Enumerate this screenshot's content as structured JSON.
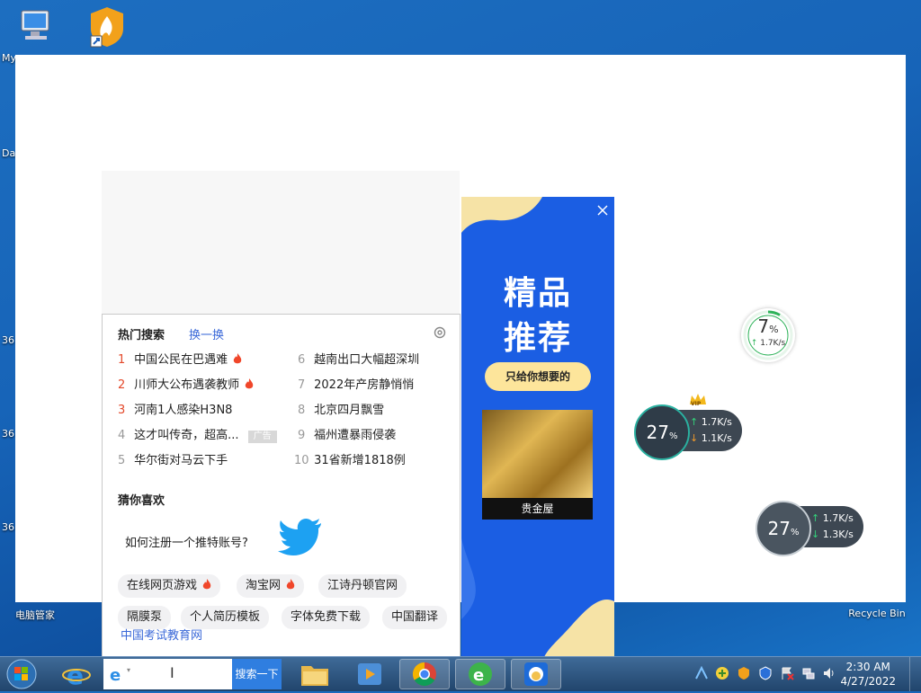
{
  "desktop": {
    "icons": {
      "computer_label": "My",
      "pc_manager_label": "电脑管家",
      "recycle_bin_label": "Recycle Bin"
    },
    "edge_labels": [
      "Da",
      "36",
      "36",
      "36"
    ]
  },
  "search_dropdown": {
    "hot_title": "热门搜索",
    "refresh_label": "换一换",
    "hot_items": [
      {
        "rank": "1",
        "text": "中国公民在巴遇难"
      },
      {
        "rank": "2",
        "text": "川师大公布遇袭教师"
      },
      {
        "rank": "3",
        "text": "河南1人感染H3N8"
      },
      {
        "rank": "4",
        "text": "这才叫传奇，超高..."
      },
      {
        "rank": "5",
        "text": "华尔街对马云下手"
      },
      {
        "rank": "6",
        "text": "越南出口大幅超深圳"
      },
      {
        "rank": "7",
        "text": "2022年产房静悄悄"
      },
      {
        "rank": "8",
        "text": "北京四月飘雪"
      },
      {
        "rank": "9",
        "text": "福州遭暴雨侵袭"
      },
      {
        "rank": "10",
        "text": "31省新增1818例"
      }
    ],
    "ad_tag": "广告",
    "guess_title": "猜你喜欢",
    "guess_question": "如何注册一个推特账号?",
    "chips": [
      "在线网页游戏",
      "淘宝网",
      "江诗丹顿官网",
      "隔膜泵",
      "个人简历模板",
      "字体免费下载",
      "中国翻译"
    ],
    "bottom_link": "中国考试教育网"
  },
  "ad_panel": {
    "title_line1": "精品",
    "title_line2": "推荐",
    "pill": "只给你想要的",
    "caption": "贵金屋"
  },
  "speed_widget_small": {
    "percent": "7",
    "unit": "%",
    "rate": "1.7K/s"
  },
  "speed_widget_vip": {
    "percent": "27",
    "unit": "%",
    "up": "1.7K/s",
    "down": "1.1K/s",
    "badge": "VIP"
  },
  "speed_widget_2": {
    "percent": "27",
    "unit": "%",
    "up": "1.7K/s",
    "down": "1.3K/s"
  },
  "taskbar": {
    "search_button": "搜索一下",
    "time": "2:30 AM",
    "date": "4/27/2022"
  },
  "colors": {
    "accent_blue": "#1b5ee3",
    "link_blue": "#3a68d8",
    "hot_red": "#e3482a"
  }
}
